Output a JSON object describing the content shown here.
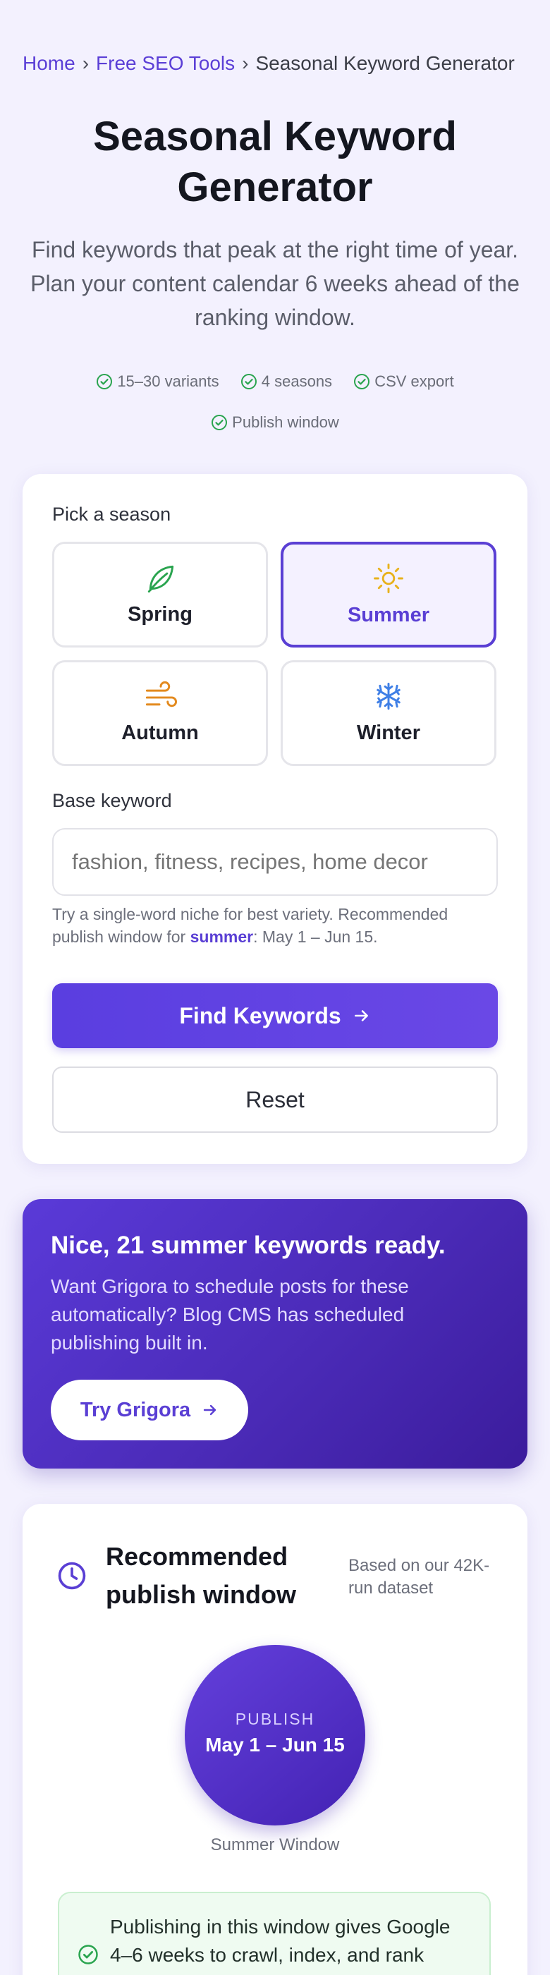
{
  "breadcrumb": {
    "home": "Home",
    "tools": "Free SEO Tools",
    "current": "Seasonal Keyword Generator",
    "separator": "›"
  },
  "hero": {
    "title": "Seasonal Keyword Generator",
    "subtitle": "Find keywords that peak at the right time of year. Plan your content calendar 6 weeks ahead of the ranking window."
  },
  "features": [
    "15–30 variants",
    "4 seasons",
    "CSV export",
    "Publish window"
  ],
  "form": {
    "season_label": "Pick a season",
    "seasons": [
      {
        "label": "Spring",
        "icon": "leaf-icon",
        "color": "#2aa44f"
      },
      {
        "label": "Summer",
        "icon": "sun-icon",
        "color": "#e8b21c",
        "selected": true
      },
      {
        "label": "Autumn",
        "icon": "wind-icon",
        "color": "#e38a1e"
      },
      {
        "label": "Winter",
        "icon": "snowflake-icon",
        "color": "#3f7fe6"
      }
    ],
    "keyword_label": "Base keyword",
    "keyword_placeholder": "fashion, fitness, recipes, home decor",
    "hint_prefix": "Try a single-word niche for best variety. Recommended publish window for ",
    "hint_season": "summer",
    "hint_suffix": ": May 1 – Jun 15.",
    "find_label": "Find Keywords",
    "reset_label": "Reset"
  },
  "promo": {
    "heading": "Nice, 21 summer keywords ready.",
    "body": "Want Grigora to schedule posts for these automatically? Blog CMS has scheduled publishing built in.",
    "cta": "Try Grigora"
  },
  "window": {
    "title": "Recommended publish window",
    "note": "Based on our 42K-run dataset",
    "kicker": "PUBLISH",
    "range": "May 1 – Jun 15",
    "caption": "Summer Window",
    "benefit": "Publishing in this window gives Google 4–6 weeks to crawl, index, and rank"
  },
  "colors": {
    "accent": "#5a3fd4",
    "check": "#2aa44f",
    "background": "#f3f1fe"
  }
}
